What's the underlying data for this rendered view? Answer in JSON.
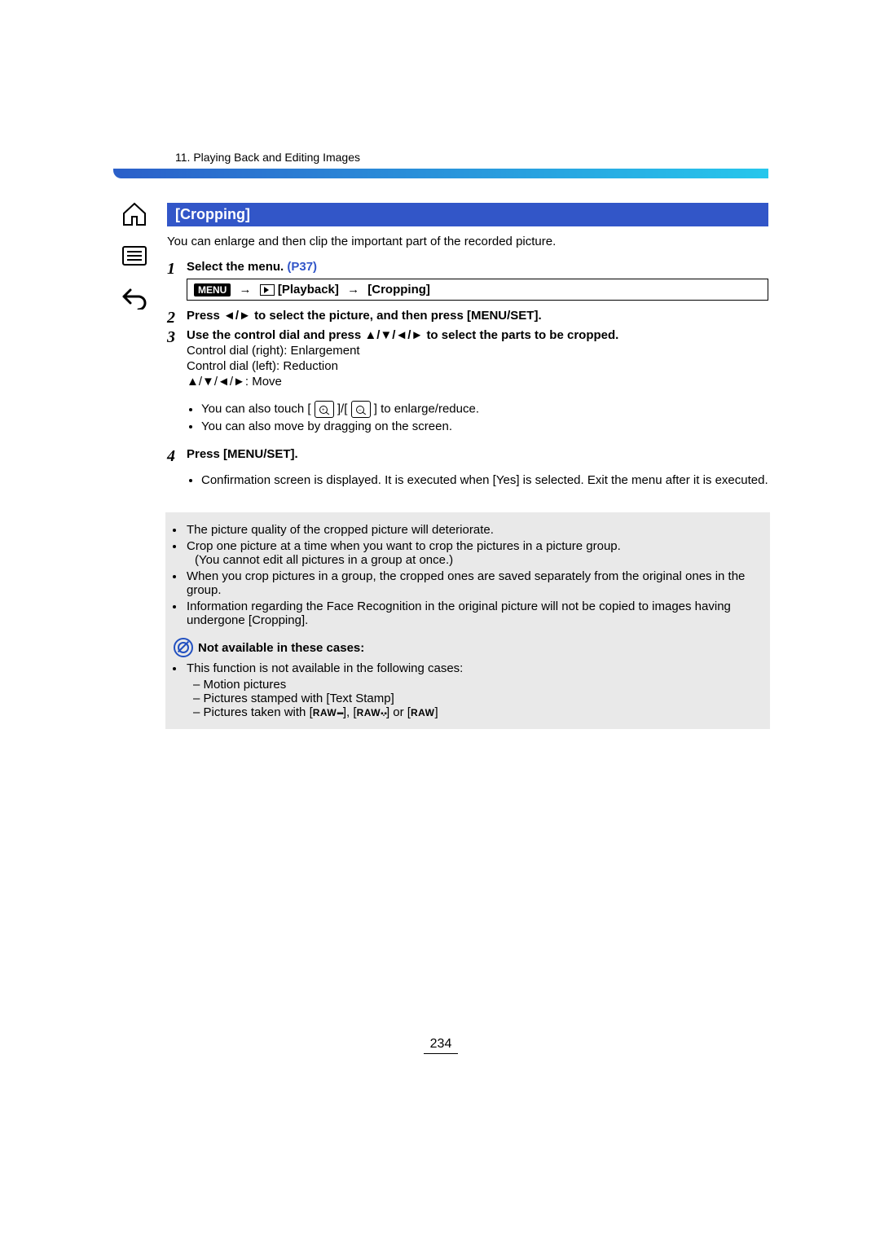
{
  "header": {
    "chapter": "11. Playing Back and Editing Images"
  },
  "section": {
    "title": "[Cropping]",
    "intro": "You can enlarge and then clip the important part of the recorded picture."
  },
  "menu_path": {
    "menu_label": "MENU",
    "level1": "[Playback]",
    "level2": "[Cropping]"
  },
  "steps": [
    {
      "num": "1",
      "main": "Select the menu. ",
      "page_ref": "(P37)",
      "show_menupath": true
    },
    {
      "num": "2",
      "main": "Press ◄/► to select the picture, and then press [MENU/SET]."
    },
    {
      "num": "3",
      "main": "Use the control dial and press ▲/▼/◄/► to select the parts to be cropped.",
      "body_lines": [
        "Control dial (right): Enlargement",
        "Control dial (left): Reduction",
        "▲/▼/◄/►: Move"
      ],
      "touch_prefix": "You can also touch [",
      "touch_mid": "]/[",
      "touch_suffix": "] to enlarge/reduce.",
      "drag_line": "You can also move by dragging on the screen."
    },
    {
      "num": "4",
      "main": "Press [MENU/SET].",
      "sub_bullets": [
        "Confirmation screen is displayed. It is executed when [Yes] is selected. Exit the menu after it is executed."
      ]
    }
  ],
  "notes_box": {
    "items": [
      {
        "text": "The picture quality of the cropped picture will deteriorate."
      },
      {
        "text": "Crop one picture at a time when you want to crop the pictures in a picture group.",
        "sub": "(You cannot edit all pictures in a group at once.)"
      },
      {
        "text": "When you crop pictures in a group, the cropped ones are saved separately from the original ones in the group."
      },
      {
        "text": "Information regarding the Face Recognition in the original picture will not be copied to images having undergone [Cropping]."
      }
    ]
  },
  "not_available": {
    "heading": "Not available in these cases:",
    "lead": "This function is not available in the following cases:",
    "cases": [
      "Motion pictures",
      "Pictures stamped with [Text Stamp]"
    ],
    "raw_line_prefix": "Pictures taken with [",
    "raw1": "RAW",
    "raw_mid1": "], [",
    "raw2": "RAW",
    "raw_mid2": "] or [",
    "raw3": "RAW",
    "raw_suffix": "]"
  },
  "page_number": "234"
}
